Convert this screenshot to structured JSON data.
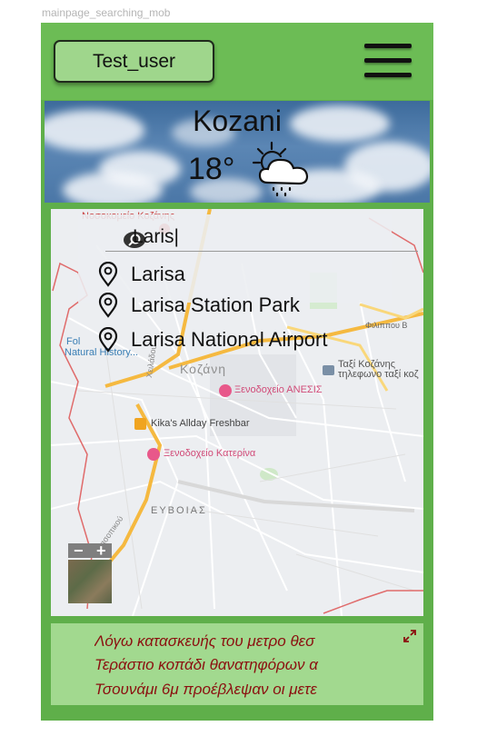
{
  "frame_label": "mainpage_searching_mob",
  "header": {
    "username": "Test_user"
  },
  "weather": {
    "city": "Kozani",
    "temperature": "18°",
    "icon": "cloud-sun-rain-icon"
  },
  "search": {
    "value": "Laris|",
    "suggestions": [
      {
        "label": "Larisa"
      },
      {
        "label": "Larisa Station Park"
      },
      {
        "label": "Larisa National Airport"
      }
    ]
  },
  "map": {
    "labels": {
      "hospital": "Νοσοκομείο Κοζάνης",
      "folk": "Fol",
      "museum": "Natural History...",
      "city": "Κοζάνη",
      "road": "Φιλιππου Β",
      "taxi": "Ταξί Κοζάνης",
      "taxi2": "τηλεφωνο ταξί κοζ",
      "hotel1": "Ξενοδοχείο ΑΝΕΣΙΣ",
      "food": "Kika's Allday Freshbar",
      "hotel2": "Ξενοδοχείο Κατερίνα",
      "area": "ΕΥΒΟΙΑΣ",
      "street": "Χειλάδου",
      "street2": "Κασοπικού"
    },
    "zoom_out": "−",
    "zoom_in": "+"
  },
  "news": {
    "lines": [
      "Λόγω κατασκευής του μετρο θεσ",
      "Τεράστιο κοπάδι θανατηφόρων α",
      "Τσουνάμι 6μ προέβλεψαν οι μετε"
    ]
  },
  "colors": {
    "frame_green": "#5faf4a",
    "header_green": "#6cbc55",
    "button_green": "#9fd68c",
    "news_green": "#a2d98f",
    "news_text": "#8b1010",
    "road_orange": "#f5b940",
    "boundary_red": "#e06b6b"
  }
}
